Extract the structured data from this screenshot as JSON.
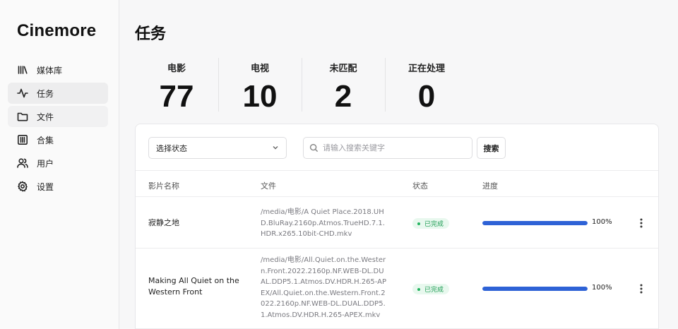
{
  "app": {
    "name": "Cinemore"
  },
  "sidebar": {
    "items": [
      {
        "label": "媒体库",
        "icon": "library-icon"
      },
      {
        "label": "任务",
        "icon": "activity-icon"
      },
      {
        "label": "文件",
        "icon": "folder-icon"
      },
      {
        "label": "合集",
        "icon": "collection-icon"
      },
      {
        "label": "用户",
        "icon": "users-icon"
      },
      {
        "label": "设置",
        "icon": "gear-icon"
      }
    ],
    "active": "任务"
  },
  "page": {
    "title": "任务"
  },
  "stats": [
    {
      "label": "电影",
      "value": "77"
    },
    {
      "label": "电视",
      "value": "10"
    },
    {
      "label": "未匹配",
      "value": "2"
    },
    {
      "label": "正在处理",
      "value": "0"
    }
  ],
  "toolbar": {
    "status_select": "选择状态",
    "search_placeholder": "请输入搜索关键字",
    "search_button": "搜索"
  },
  "table": {
    "columns": [
      "影片名称",
      "文件",
      "状态",
      "进度"
    ],
    "rows": [
      {
        "name": "寂静之地",
        "file": "/media/电影/A Quiet Place.2018.UHD.BluRay.2160p.Atmos.TrueHD.7.1.HDR.x265.10bit-CHD.mkv",
        "status": "已完成",
        "progress": 1.0,
        "progress_label": "100%"
      },
      {
        "name": "Making All Quiet on the Western Front",
        "file": "/media/电影/All.Quiet.on.the.Western.Front.2022.2160p.NF.WEB-DL.DUAL.DDP5.1.Atmos.DV.HDR.H.265-APEX/All.Quiet.on.the.Western.Front.2022.2160p.NF.WEB-DL.DUAL.DDP5.1.Atmos.DV.HDR.H.265-APEX.mkv",
        "status": "已完成",
        "progress": 1.0,
        "progress_label": "100%"
      }
    ]
  },
  "colors": {
    "accent": "#2e62d6",
    "success": "#1f9d55"
  }
}
